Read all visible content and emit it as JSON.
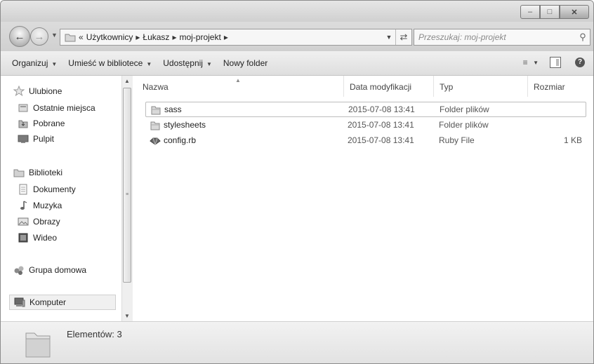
{
  "window": {
    "buttons": {
      "minimize": "minimize-icon",
      "maximize": "maximize-icon",
      "close": "close-icon"
    }
  },
  "address": {
    "breadcrumbs": [
      "Użytkownicy",
      "Łukasz",
      "moj-projekt"
    ],
    "prefix": "«",
    "search_placeholder": "Przeszukaj: moj-projekt"
  },
  "toolbar": {
    "organize": "Organizuj",
    "include_library": "Umieść w bibliotece",
    "share": "Udostępnij",
    "new_folder": "Nowy folder"
  },
  "nav": {
    "favorites": "Ulubione",
    "recent": "Ostatnie miejsca",
    "downloads": "Pobrane",
    "desktop": "Pulpit",
    "libraries": "Biblioteki",
    "documents": "Dokumenty",
    "music": "Muzyka",
    "pictures": "Obrazy",
    "video": "Wideo",
    "homegroup": "Grupa domowa",
    "computer": "Komputer"
  },
  "columns": {
    "name": "Nazwa",
    "modified": "Data modyfikacji",
    "type": "Typ",
    "size": "Rozmiar"
  },
  "files": [
    {
      "name": "sass",
      "modified": "2015-07-08 13:41",
      "type": "Folder plików",
      "size": "",
      "icon": "folder-icon"
    },
    {
      "name": "stylesheets",
      "modified": "2015-07-08 13:41",
      "type": "Folder plików",
      "size": "",
      "icon": "folder-icon"
    },
    {
      "name": "config.rb",
      "modified": "2015-07-08 13:41",
      "type": "Ruby File",
      "size": "1 KB",
      "icon": "ruby-file-icon"
    }
  ],
  "status": {
    "items_count": "Elementów: 3"
  }
}
